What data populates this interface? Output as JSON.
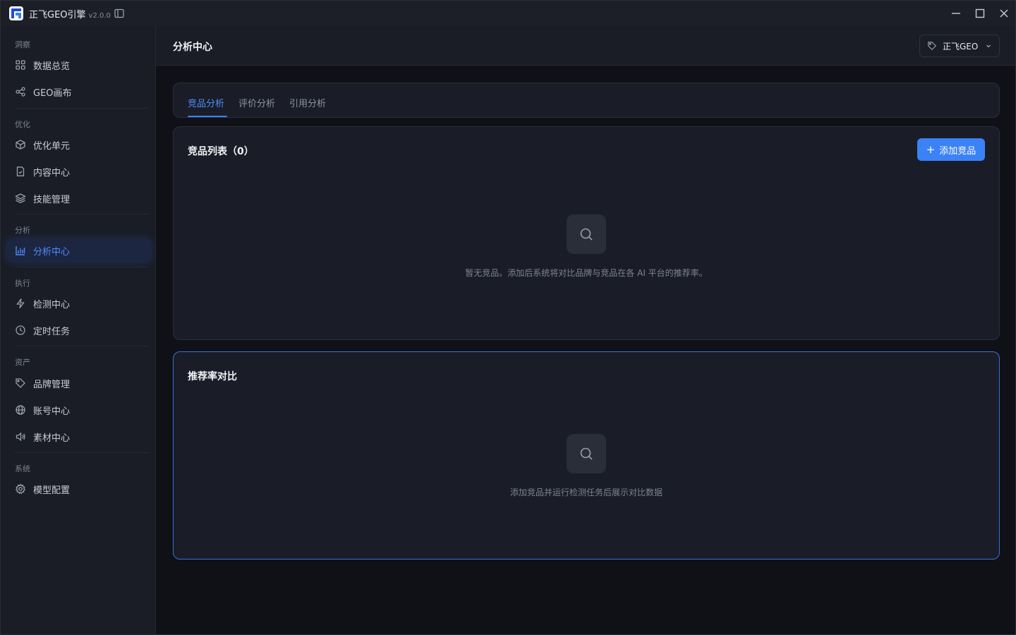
{
  "app": {
    "title": "正飞GEO引擎",
    "version": "v2.0.0"
  },
  "sidebar": {
    "sections": [
      {
        "label": "洞察",
        "items": [
          {
            "label": "数据总览",
            "icon": "grid-icon"
          },
          {
            "label": "GEO画布",
            "icon": "share-nodes-icon"
          }
        ]
      },
      {
        "label": "优化",
        "items": [
          {
            "label": "优化单元",
            "icon": "cube-icon"
          },
          {
            "label": "内容中心",
            "icon": "document-icon"
          },
          {
            "label": "技能管理",
            "icon": "layers-icon"
          }
        ]
      },
      {
        "label": "分析",
        "items": [
          {
            "label": "分析中心",
            "icon": "bar-chart-icon"
          }
        ]
      },
      {
        "label": "执行",
        "items": [
          {
            "label": "检测中心",
            "icon": "lightning-icon"
          },
          {
            "label": "定时任务",
            "icon": "clock-icon"
          }
        ]
      },
      {
        "label": "资产",
        "items": [
          {
            "label": "品牌管理",
            "icon": "tag-icon"
          },
          {
            "label": "账号中心",
            "icon": "globe-icon"
          },
          {
            "label": "素材中心",
            "icon": "speaker-icon"
          }
        ]
      },
      {
        "label": "系统",
        "items": [
          {
            "label": "模型配置",
            "icon": "gear-icon"
          }
        ]
      }
    ],
    "active_item": "分析中心"
  },
  "header": {
    "title": "分析中心",
    "brand": "正飞GEO"
  },
  "tabs": [
    {
      "label": "竞品分析",
      "active": true
    },
    {
      "label": "评价分析",
      "active": false
    },
    {
      "label": "引用分析",
      "active": false
    }
  ],
  "competitor_card": {
    "title": "竞品列表（0）",
    "add_button": "添加竞品",
    "empty_text": "暂无竞品。添加后系统将对比品牌与竞品在各 AI 平台的推荐率。"
  },
  "rate_card": {
    "title": "推荐率对比",
    "empty_text": "添加竞品并运行检测任务后展示对比数据"
  },
  "colors": {
    "accent": "#3b82f6",
    "active_text": "#4d8dff",
    "sidebar_bg": "#1a1d26",
    "main_bg": "#0f1117"
  }
}
